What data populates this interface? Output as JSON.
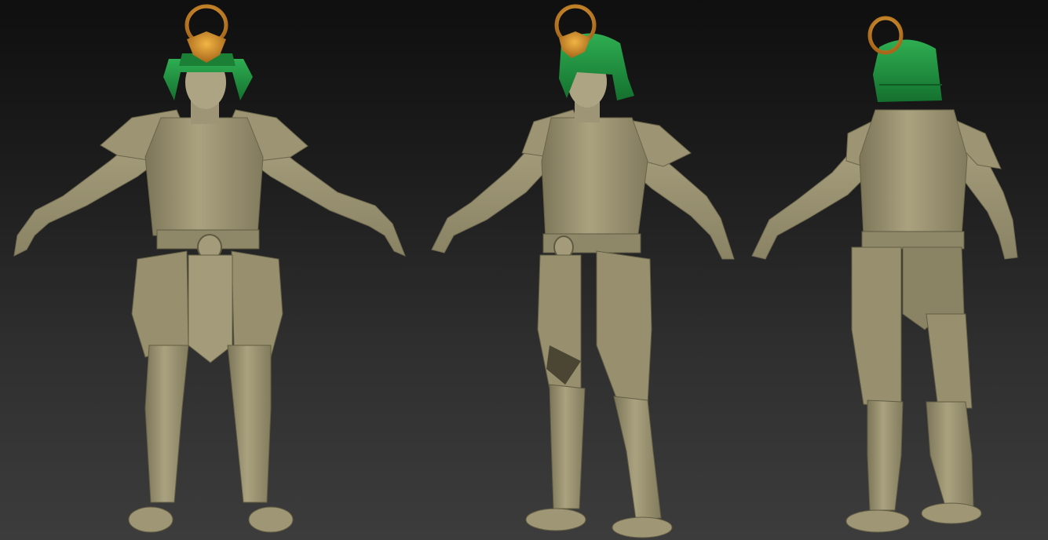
{
  "scene": {
    "background_top": "#0f0f0f",
    "background_bottom": "#3c3c3c",
    "skin_color": "#a9a080",
    "armor_color": "#9e9674",
    "armor_shadow": "#6f6950",
    "helmet_green": "#1e8e3e",
    "crest_gold": "#c98a22",
    "figures": [
      {
        "view": "front",
        "icon": "figure-front"
      },
      {
        "view": "three-quarter",
        "icon": "figure-three-quarter"
      },
      {
        "view": "back",
        "icon": "figure-back"
      }
    ]
  }
}
